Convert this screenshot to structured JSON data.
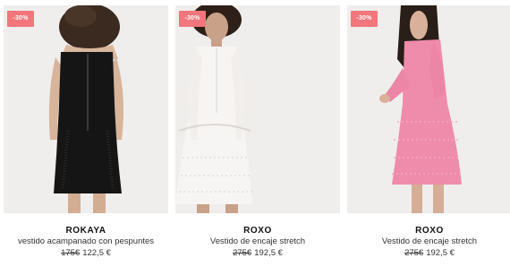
{
  "products": [
    {
      "discount": "-30%",
      "brand": "ROKAYA",
      "description": "vestido acampanado con pespuntes",
      "old_price": "175€",
      "new_price": "122,5 €",
      "image": "black-dress-back-view"
    },
    {
      "discount": "-30%",
      "brand": "ROXO",
      "description": "Vestido de encaje stretch",
      "old_price": "275€",
      "new_price": "192,5 €",
      "image": "white-lace-dress"
    },
    {
      "discount": "-30%",
      "brand": "ROXO",
      "description": "Vestido de encaje stretch",
      "old_price": "275€",
      "new_price": "192,5 €",
      "image": "pink-lace-dress"
    }
  ],
  "colors": {
    "badge": "#f2767b",
    "photo_bg": "#efeeec",
    "text": "#333333"
  }
}
